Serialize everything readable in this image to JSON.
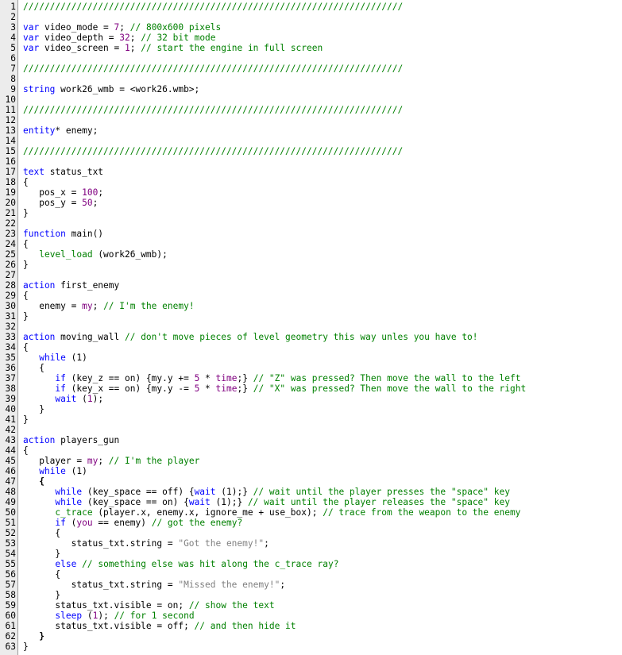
{
  "editor": {
    "lines": [
      {
        "n": "1",
        "t": [
          {
            "c": "cm",
            "s": "///////////////////////////////////////////////////////////////////////"
          }
        ]
      },
      {
        "n": "2",
        "t": []
      },
      {
        "n": "3",
        "t": [
          {
            "c": "kw",
            "s": "var"
          },
          {
            "c": "pl",
            "s": " video_mode = "
          },
          {
            "c": "nm",
            "s": "7"
          },
          {
            "c": "pl",
            "s": "; "
          },
          {
            "c": "cm",
            "s": "// 800x600 pixels"
          }
        ]
      },
      {
        "n": "4",
        "t": [
          {
            "c": "kw",
            "s": "var"
          },
          {
            "c": "pl",
            "s": " video_depth = "
          },
          {
            "c": "nm",
            "s": "32"
          },
          {
            "c": "pl",
            "s": "; "
          },
          {
            "c": "cm",
            "s": "// 32 bit mode"
          }
        ]
      },
      {
        "n": "5",
        "t": [
          {
            "c": "kw",
            "s": "var"
          },
          {
            "c": "pl",
            "s": " video_screen = "
          },
          {
            "c": "nm",
            "s": "1"
          },
          {
            "c": "pl",
            "s": "; "
          },
          {
            "c": "cm",
            "s": "// start the engine in full screen"
          }
        ]
      },
      {
        "n": "6",
        "t": []
      },
      {
        "n": "7",
        "t": [
          {
            "c": "cm",
            "s": "///////////////////////////////////////////////////////////////////////"
          }
        ]
      },
      {
        "n": "8",
        "t": []
      },
      {
        "n": "9",
        "t": [
          {
            "c": "kw",
            "s": "string"
          },
          {
            "c": "pl",
            "s": " work26_wmb = <work26.wmb>;"
          }
        ]
      },
      {
        "n": "10",
        "t": []
      },
      {
        "n": "11",
        "t": [
          {
            "c": "cm",
            "s": "///////////////////////////////////////////////////////////////////////"
          }
        ]
      },
      {
        "n": "12",
        "t": []
      },
      {
        "n": "13",
        "t": [
          {
            "c": "kw",
            "s": "entity"
          },
          {
            "c": "pl",
            "s": "* enemy;"
          }
        ]
      },
      {
        "n": "14",
        "t": []
      },
      {
        "n": "15",
        "t": [
          {
            "c": "cm",
            "s": "///////////////////////////////////////////////////////////////////////"
          }
        ]
      },
      {
        "n": "16",
        "t": []
      },
      {
        "n": "17",
        "t": [
          {
            "c": "kw",
            "s": "text"
          },
          {
            "c": "pl",
            "s": " status_txt"
          }
        ]
      },
      {
        "n": "18",
        "t": [
          {
            "c": "pl",
            "s": "{"
          }
        ]
      },
      {
        "n": "19",
        "t": [
          {
            "c": "pl",
            "s": "   pos_x = "
          },
          {
            "c": "nm",
            "s": "100"
          },
          {
            "c": "pl",
            "s": ";"
          }
        ]
      },
      {
        "n": "20",
        "t": [
          {
            "c": "pl",
            "s": "   pos_y = "
          },
          {
            "c": "nm",
            "s": "50"
          },
          {
            "c": "pl",
            "s": ";"
          }
        ]
      },
      {
        "n": "21",
        "t": [
          {
            "c": "pl",
            "s": "}"
          }
        ]
      },
      {
        "n": "22",
        "t": []
      },
      {
        "n": "23",
        "t": [
          {
            "c": "kw",
            "s": "function"
          },
          {
            "c": "pl",
            "s": " main()"
          }
        ]
      },
      {
        "n": "24",
        "t": [
          {
            "c": "pl",
            "s": "{"
          }
        ]
      },
      {
        "n": "25",
        "t": [
          {
            "c": "pl",
            "s": "   "
          },
          {
            "c": "cm",
            "s": "level_load"
          },
          {
            "c": "pl",
            "s": " (work26_wmb);"
          }
        ]
      },
      {
        "n": "26",
        "t": [
          {
            "c": "pl",
            "s": "}"
          }
        ]
      },
      {
        "n": "27",
        "t": []
      },
      {
        "n": "28",
        "t": [
          {
            "c": "kw",
            "s": "action"
          },
          {
            "c": "pl",
            "s": " first_enemy"
          }
        ]
      },
      {
        "n": "29",
        "t": [
          {
            "c": "pl",
            "s": "{"
          }
        ]
      },
      {
        "n": "30",
        "t": [
          {
            "c": "pl",
            "s": "   enemy = "
          },
          {
            "c": "nm",
            "s": "my"
          },
          {
            "c": "pl",
            "s": "; "
          },
          {
            "c": "cm",
            "s": "// I'm the enemy!"
          }
        ]
      },
      {
        "n": "31",
        "t": [
          {
            "c": "pl",
            "s": "}"
          }
        ]
      },
      {
        "n": "32",
        "t": []
      },
      {
        "n": "33",
        "t": [
          {
            "c": "kw",
            "s": "action"
          },
          {
            "c": "pl",
            "s": " moving_wall "
          },
          {
            "c": "cm",
            "s": "// don't move pieces of level geometry this way unles you have to!"
          }
        ]
      },
      {
        "n": "34",
        "t": [
          {
            "c": "pl",
            "s": "{"
          }
        ]
      },
      {
        "n": "35",
        "t": [
          {
            "c": "pl",
            "s": "   "
          },
          {
            "c": "kw",
            "s": "while"
          },
          {
            "c": "pl",
            "s": " (1)"
          }
        ]
      },
      {
        "n": "36",
        "t": [
          {
            "c": "pl",
            "s": "   {"
          }
        ]
      },
      {
        "n": "37",
        "t": [
          {
            "c": "pl",
            "s": "      "
          },
          {
            "c": "kw",
            "s": "if"
          },
          {
            "c": "pl",
            "s": " (key_z == on) {my.y += "
          },
          {
            "c": "nm",
            "s": "5"
          },
          {
            "c": "pl",
            "s": " * "
          },
          {
            "c": "nm",
            "s": "time"
          },
          {
            "c": "pl",
            "s": ";} "
          },
          {
            "c": "cm",
            "s": "// \"Z\" was pressed? Then move the wall to the left"
          }
        ]
      },
      {
        "n": "38",
        "t": [
          {
            "c": "pl",
            "s": "      "
          },
          {
            "c": "kw",
            "s": "if"
          },
          {
            "c": "pl",
            "s": " (key_x == on) {my.y -= "
          },
          {
            "c": "nm",
            "s": "5"
          },
          {
            "c": "pl",
            "s": " * "
          },
          {
            "c": "nm",
            "s": "time"
          },
          {
            "c": "pl",
            "s": ";} "
          },
          {
            "c": "cm",
            "s": "// \"X\" was pressed? Then move the wall to the right"
          }
        ]
      },
      {
        "n": "39",
        "t": [
          {
            "c": "pl",
            "s": "      "
          },
          {
            "c": "kw",
            "s": "wait"
          },
          {
            "c": "pl",
            "s": " ("
          },
          {
            "c": "nm",
            "s": "1"
          },
          {
            "c": "pl",
            "s": ");"
          }
        ]
      },
      {
        "n": "40",
        "t": [
          {
            "c": "pl",
            "s": "   }"
          }
        ]
      },
      {
        "n": "41",
        "t": [
          {
            "c": "pl",
            "s": "}"
          }
        ]
      },
      {
        "n": "42",
        "t": []
      },
      {
        "n": "43",
        "t": [
          {
            "c": "kw",
            "s": "action"
          },
          {
            "c": "pl",
            "s": " players_gun"
          }
        ]
      },
      {
        "n": "44",
        "t": [
          {
            "c": "pl",
            "s": "{"
          }
        ]
      },
      {
        "n": "45",
        "t": [
          {
            "c": "pl",
            "s": "   player = "
          },
          {
            "c": "nm",
            "s": "my"
          },
          {
            "c": "pl",
            "s": "; "
          },
          {
            "c": "cm",
            "s": "// I'm the player"
          }
        ]
      },
      {
        "n": "46",
        "t": [
          {
            "c": "pl",
            "s": "   "
          },
          {
            "c": "kw",
            "s": "while"
          },
          {
            "c": "pl",
            "s": " (1)"
          }
        ]
      },
      {
        "n": "47",
        "t": [
          {
            "c": "pl bold",
            "s": "   {"
          }
        ]
      },
      {
        "n": "48",
        "t": [
          {
            "c": "pl",
            "s": "      "
          },
          {
            "c": "kw",
            "s": "while"
          },
          {
            "c": "pl",
            "s": " (key_space == off) {"
          },
          {
            "c": "kw",
            "s": "wait"
          },
          {
            "c": "pl",
            "s": " (1);} "
          },
          {
            "c": "cm",
            "s": "// wait until the player presses the \"space\" key"
          }
        ]
      },
      {
        "n": "49",
        "t": [
          {
            "c": "pl",
            "s": "      "
          },
          {
            "c": "kw",
            "s": "while"
          },
          {
            "c": "pl",
            "s": " (key_space == on) {"
          },
          {
            "c": "kw",
            "s": "wait"
          },
          {
            "c": "pl",
            "s": " (1);} "
          },
          {
            "c": "cm",
            "s": "// wait until the player releases the \"space\" key"
          }
        ]
      },
      {
        "n": "50",
        "t": [
          {
            "c": "pl",
            "s": "      "
          },
          {
            "c": "cm",
            "s": "c_trace"
          },
          {
            "c": "pl",
            "s": " (player.x, enemy.x, ignore_me + use_box); "
          },
          {
            "c": "cm",
            "s": "// trace from the weapon to the enemy"
          }
        ]
      },
      {
        "n": "51",
        "t": [
          {
            "c": "pl",
            "s": "      "
          },
          {
            "c": "kw",
            "s": "if"
          },
          {
            "c": "pl",
            "s": " ("
          },
          {
            "c": "nm",
            "s": "you"
          },
          {
            "c": "pl",
            "s": " == enemy) "
          },
          {
            "c": "cm",
            "s": "// got the enemy?"
          }
        ]
      },
      {
        "n": "52",
        "t": [
          {
            "c": "pl",
            "s": "      {"
          }
        ]
      },
      {
        "n": "53",
        "t": [
          {
            "c": "pl",
            "s": "         status_txt.string = "
          },
          {
            "c": "st",
            "s": "\"Got the enemy!\""
          },
          {
            "c": "pl",
            "s": ";"
          }
        ]
      },
      {
        "n": "54",
        "t": [
          {
            "c": "pl",
            "s": "      }"
          }
        ]
      },
      {
        "n": "55",
        "t": [
          {
            "c": "pl",
            "s": "      "
          },
          {
            "c": "kw",
            "s": "else"
          },
          {
            "c": "pl",
            "s": " "
          },
          {
            "c": "cm",
            "s": "// something else was hit along the c_trace ray?"
          }
        ]
      },
      {
        "n": "56",
        "t": [
          {
            "c": "pl",
            "s": "      {"
          }
        ]
      },
      {
        "n": "57",
        "t": [
          {
            "c": "pl",
            "s": "         status_txt.string = "
          },
          {
            "c": "st",
            "s": "\"Missed the enemy!\""
          },
          {
            "c": "pl",
            "s": ";"
          }
        ]
      },
      {
        "n": "58",
        "t": [
          {
            "c": "pl",
            "s": "      }"
          }
        ]
      },
      {
        "n": "59",
        "t": [
          {
            "c": "pl",
            "s": "      status_txt.visible = on; "
          },
          {
            "c": "cm",
            "s": "// show the text"
          }
        ]
      },
      {
        "n": "60",
        "t": [
          {
            "c": "pl",
            "s": "      "
          },
          {
            "c": "kw",
            "s": "sleep"
          },
          {
            "c": "pl",
            "s": " ("
          },
          {
            "c": "nm",
            "s": "1"
          },
          {
            "c": "pl",
            "s": "); "
          },
          {
            "c": "cm",
            "s": "// for 1 second"
          }
        ]
      },
      {
        "n": "61",
        "t": [
          {
            "c": "pl",
            "s": "      status_txt.visible = off; "
          },
          {
            "c": "cm",
            "s": "// and then hide it"
          }
        ]
      },
      {
        "n": "62",
        "t": [
          {
            "c": "pl bold",
            "s": "   }"
          }
        ]
      },
      {
        "n": "63",
        "t": [
          {
            "c": "pl",
            "s": "}"
          }
        ]
      }
    ]
  }
}
